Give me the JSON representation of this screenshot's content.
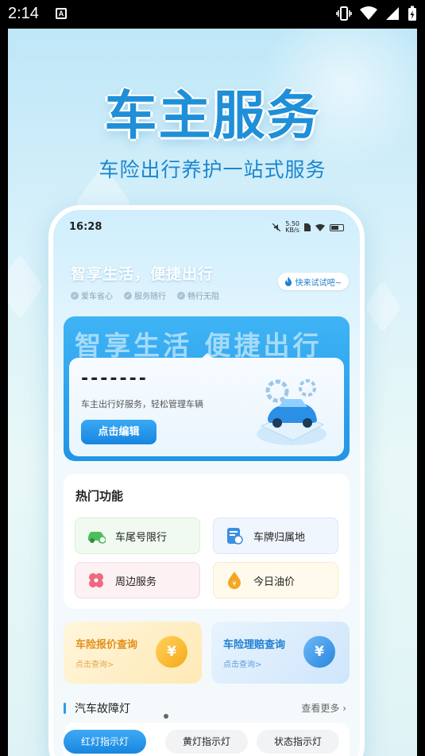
{
  "system_status": {
    "time": "2:14",
    "notification_icon": "A"
  },
  "hero": {
    "title": "车主服务",
    "subtitle": "车险出行养护一站式服务"
  },
  "inner_status": {
    "time": "16:28",
    "speed_value": "5.50",
    "speed_unit": "KB/s"
  },
  "header": {
    "slogan": "智享生活，便捷出行",
    "try_label": "快来试试吧~",
    "tags": [
      "爱车省心",
      "服务随行",
      "畅行无阻"
    ]
  },
  "banner": {
    "watermark": "智享生活 便捷出行",
    "plate": "-------",
    "desc": "车主出行好服务，轻松管理车辆",
    "edit_label": "点击编辑"
  },
  "hot": {
    "title": "热门功能",
    "items": [
      {
        "label": "车尾号限行",
        "icon": "car-icon",
        "color": "#4bbf5b"
      },
      {
        "label": "车牌归属地",
        "icon": "plate-icon",
        "color": "#3b8fe0"
      },
      {
        "label": "周边服务",
        "icon": "flower-icon",
        "color": "#f06a7f"
      },
      {
        "label": "今日油价",
        "icon": "oil-drop-icon",
        "color": "#f5a623"
      }
    ]
  },
  "insurance": {
    "quote": {
      "title": "车险报价查询",
      "sub": "点击查询>",
      "coin": "¥"
    },
    "claim": {
      "title": "车险理赔查询",
      "sub": "点击查询>",
      "coin": "¥"
    }
  },
  "fault": {
    "title": "汽车故障灯",
    "more": "查看更多"
  },
  "chips": [
    "红灯指示灯",
    "黄灯指示灯",
    "状态指示灯"
  ],
  "colors": {
    "primary": "#1f8fd8",
    "accent_blue": "#2f9ae9"
  }
}
